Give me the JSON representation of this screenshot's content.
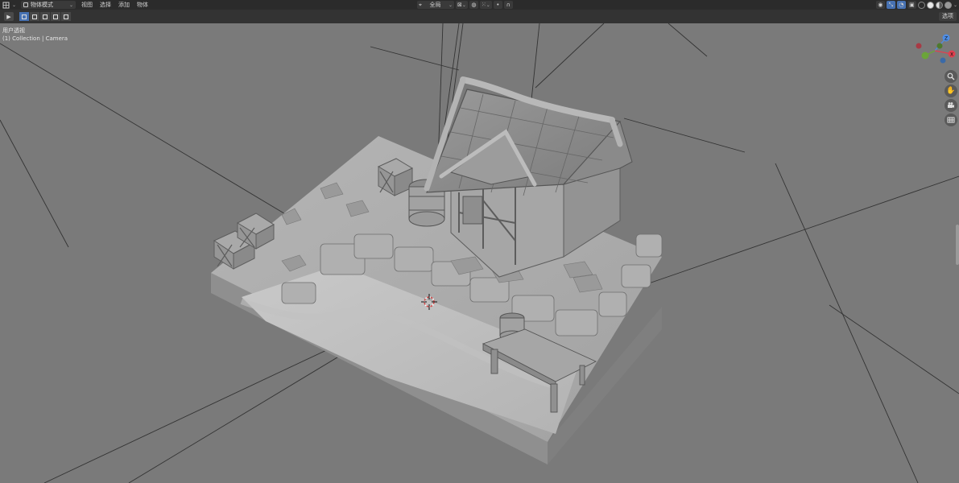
{
  "header": {
    "mode_label": "物体模式",
    "menus": [
      "视图",
      "选择",
      "添加",
      "物体"
    ],
    "transform_orientation": "全局"
  },
  "subbar": {
    "options_label": "选项"
  },
  "viewport": {
    "view_name": "用户透视",
    "collection_info": "(1) Collection | Camera"
  },
  "gizmo": {
    "x_label": "X",
    "y_label": "Y",
    "z_label": "Z",
    "colors": {
      "x": "#e0404f",
      "y": "#6ba539",
      "z": "#4f8ee6"
    }
  },
  "icons": {
    "editor_type": "cube-grid-icon",
    "play": "play-icon",
    "zoom": "magnifier-icon",
    "pan": "hand-icon",
    "camera": "camera-icon",
    "ortho": "grid-icon"
  }
}
